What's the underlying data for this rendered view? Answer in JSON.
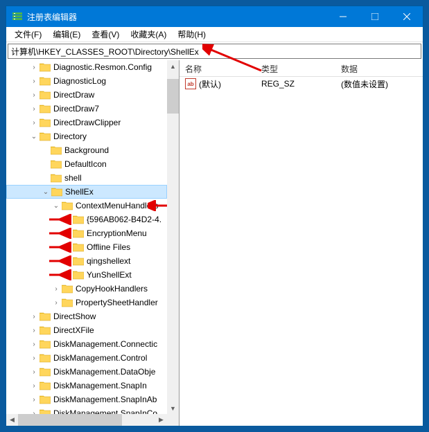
{
  "title": "注册表编辑器",
  "menu": {
    "file": "文件(F)",
    "edit": "编辑(E)",
    "view": "查看(V)",
    "favorites": "收藏夹(A)",
    "help": "帮助(H)"
  },
  "address": "计算机\\HKEY_CLASSES_ROOT\\Directory\\ShellEx",
  "tree": [
    {
      "indent": 2,
      "exp": ">",
      "label": "Diagnostic.Resmon.Config"
    },
    {
      "indent": 2,
      "exp": ">",
      "label": "DiagnosticLog"
    },
    {
      "indent": 2,
      "exp": ">",
      "label": "DirectDraw"
    },
    {
      "indent": 2,
      "exp": ">",
      "label": "DirectDraw7"
    },
    {
      "indent": 2,
      "exp": ">",
      "label": "DirectDrawClipper"
    },
    {
      "indent": 2,
      "exp": "v",
      "label": "Directory"
    },
    {
      "indent": 3,
      "exp": "",
      "label": "Background"
    },
    {
      "indent": 3,
      "exp": "",
      "label": "DefaultIcon"
    },
    {
      "indent": 3,
      "exp": "",
      "label": "shell"
    },
    {
      "indent": 3,
      "exp": "v",
      "label": "ShellEx",
      "selected": true
    },
    {
      "indent": 4,
      "exp": "v",
      "label": "ContextMenuHandlers",
      "arrow": "right"
    },
    {
      "indent": 5,
      "exp": "",
      "label": "{596AB062-B4D2-4.",
      "arrow": "left"
    },
    {
      "indent": 5,
      "exp": "",
      "label": "EncryptionMenu",
      "arrow": "left"
    },
    {
      "indent": 5,
      "exp": "",
      "label": "Offline Files",
      "arrow": "left"
    },
    {
      "indent": 5,
      "exp": "",
      "label": "qingshellext",
      "arrow": "left"
    },
    {
      "indent": 5,
      "exp": "",
      "label": "YunShellExt",
      "arrow": "left"
    },
    {
      "indent": 4,
      "exp": ">",
      "label": "CopyHookHandlers"
    },
    {
      "indent": 4,
      "exp": ">",
      "label": "PropertySheetHandler"
    },
    {
      "indent": 2,
      "exp": ">",
      "label": "DirectShow"
    },
    {
      "indent": 2,
      "exp": ">",
      "label": "DirectXFile"
    },
    {
      "indent": 2,
      "exp": ">",
      "label": "DiskManagement.Connectic"
    },
    {
      "indent": 2,
      "exp": ">",
      "label": "DiskManagement.Control"
    },
    {
      "indent": 2,
      "exp": ">",
      "label": "DiskManagement.DataObje"
    },
    {
      "indent": 2,
      "exp": ">",
      "label": "DiskManagement.SnapIn"
    },
    {
      "indent": 2,
      "exp": ">",
      "label": "DiskManagement.SnapInAb"
    },
    {
      "indent": 2,
      "exp": ">",
      "label": "DiskManagement.SnapInCo"
    }
  ],
  "list": {
    "headers": {
      "name": "名称",
      "type": "类型",
      "data": "数据"
    },
    "rows": [
      {
        "name": "(默认)",
        "type": "REG_SZ",
        "data": "(数值未设置)"
      }
    ]
  }
}
